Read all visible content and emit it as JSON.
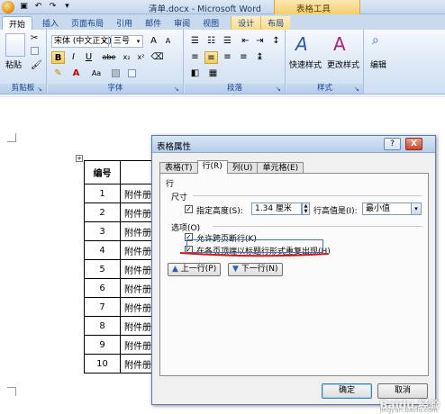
{
  "window": {
    "title": "清单.docx - Microsoft Word",
    "context_tool": "表格工具"
  },
  "ribbon_tabs": [
    "开始",
    "插入",
    "页面布局",
    "引用",
    "邮件",
    "审阅",
    "视图",
    "设计",
    "布局"
  ],
  "ribbon": {
    "clipboard": {
      "paste": "粘贴",
      "label": "剪贴板"
    },
    "font": {
      "name": "宋体 (中文正文)",
      "size": "三号",
      "label": "字体",
      "bold": "B",
      "italic": "I",
      "underline": "U",
      "strike": "abe",
      "sub": "x₂",
      "sup": "x²",
      "aa": "Aa",
      "grow": "A",
      "shrink": "A"
    },
    "paragraph": {
      "label": "段落"
    },
    "styles": {
      "quick": "快速样式",
      "change": "更改样式",
      "label": "样式"
    },
    "editing": {
      "edit": "编辑"
    }
  },
  "doc_table": {
    "header": "编号",
    "rows": [
      {
        "num": "1",
        "text": "附件册"
      },
      {
        "num": "2",
        "text": "附件册"
      },
      {
        "num": "3",
        "text": "附件册"
      },
      {
        "num": "4",
        "text": "附件册"
      },
      {
        "num": "5",
        "text": "附件册"
      },
      {
        "num": "6",
        "text": "附件册"
      },
      {
        "num": "7",
        "text": "附件册"
      },
      {
        "num": "8",
        "text": "附件册"
      },
      {
        "num": "9",
        "text": "附件册"
      },
      {
        "num": "10",
        "text": "附件册"
      }
    ]
  },
  "dialog": {
    "title": "表格属性",
    "help": "?",
    "close": "X",
    "tabs": [
      "表格(T)",
      "行(R)",
      "列(U)",
      "单元格(E)"
    ],
    "active_tab": "行(R)",
    "section_row": "行",
    "size_label": "尺寸",
    "specify_height": "指定高度(S):",
    "height_value": "1.34 厘米",
    "row_height_is": "行高值是(I):",
    "row_height_mode": "最小值",
    "options_label": "选项(O)",
    "allow_break": "允许跨页断行(K)",
    "repeat_header": "在各页顶端以标题行形式重复出现(H)",
    "prev_row": "上一行(P)",
    "next_row": "下一行(N)",
    "ok": "确定",
    "cancel": "取消"
  },
  "watermark": {
    "main": "Baidu 经验",
    "sub": "jingyan.baidu.com"
  }
}
